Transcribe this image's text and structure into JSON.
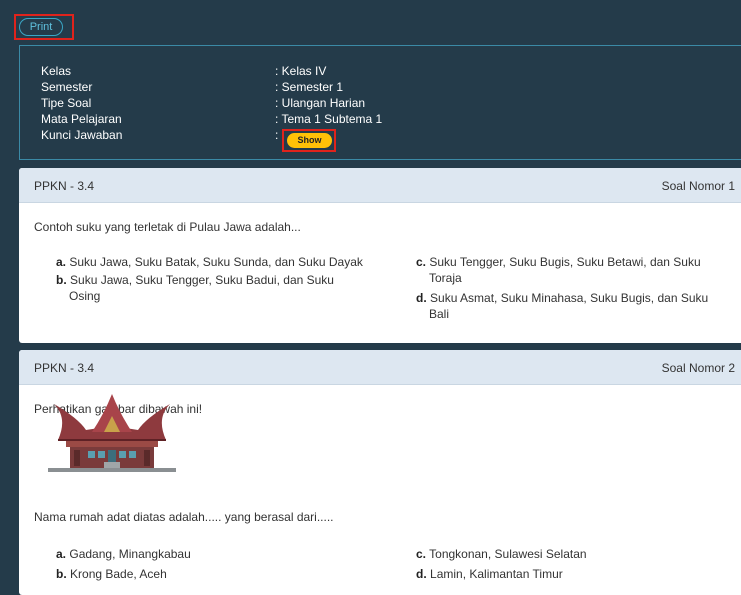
{
  "toolbar": {
    "print_label": "Print"
  },
  "info": {
    "rows": [
      {
        "label": "Kelas",
        "value": ": Kelas IV"
      },
      {
        "label": "Semester",
        "value": ": Semester 1"
      },
      {
        "label": "Tipe Soal",
        "value": ": Ulangan Harian"
      },
      {
        "label": "Mata Pelajaran",
        "value": ": Tema 1 Subtema 1"
      },
      {
        "label": "Kunci Jawaban",
        "value": ":"
      }
    ],
    "show_label": "Show"
  },
  "questions": [
    {
      "code": "PPKN - 3.4",
      "number": "Soal Nomor 1",
      "text": "Contoh suku yang terletak di Pulau Jawa adalah...",
      "options": {
        "a": {
          "letter": "a.",
          "line1": "Suku Jawa, Suku Batak, Suku Sunda, dan Suku Dayak",
          "line2": ""
        },
        "b": {
          "letter": "b.",
          "line1": "Suku Jawa, Suku Tengger, Suku Badui, dan Suku",
          "line2": "Osing"
        },
        "c": {
          "letter": "c.",
          "line1": "Suku Tengger, Suku Bugis, Suku Betawi, dan Suku",
          "line2": "Toraja"
        },
        "d": {
          "letter": "d.",
          "line1": "Suku Asmat, Suku Minahasa, Suku Bugis, dan Suku",
          "line2": "Bali"
        }
      }
    },
    {
      "code": "PPKN - 3.4",
      "number": "Soal Nomor 2",
      "text": "Perhatikan gambar dibawah ini!",
      "text2": "Nama rumah adat diatas adalah..... yang berasal dari.....",
      "image_icon": "rumah-gadang-illustration",
      "options": {
        "a": {
          "letter": "a.",
          "line1": "Gadang, Minangkabau"
        },
        "b": {
          "letter": "b.",
          "line1": "Krong Bade, Aceh"
        },
        "c": {
          "letter": "c.",
          "line1": "Tongkonan, Sulawesi Selatan"
        },
        "d": {
          "letter": "d.",
          "line1": "Lamin, Kalimantan Timur"
        }
      }
    }
  ],
  "colors": {
    "background": "#243b4a",
    "card_header": "#dde7f1",
    "show_button": "#ffc107",
    "highlight": "#e0231c"
  }
}
